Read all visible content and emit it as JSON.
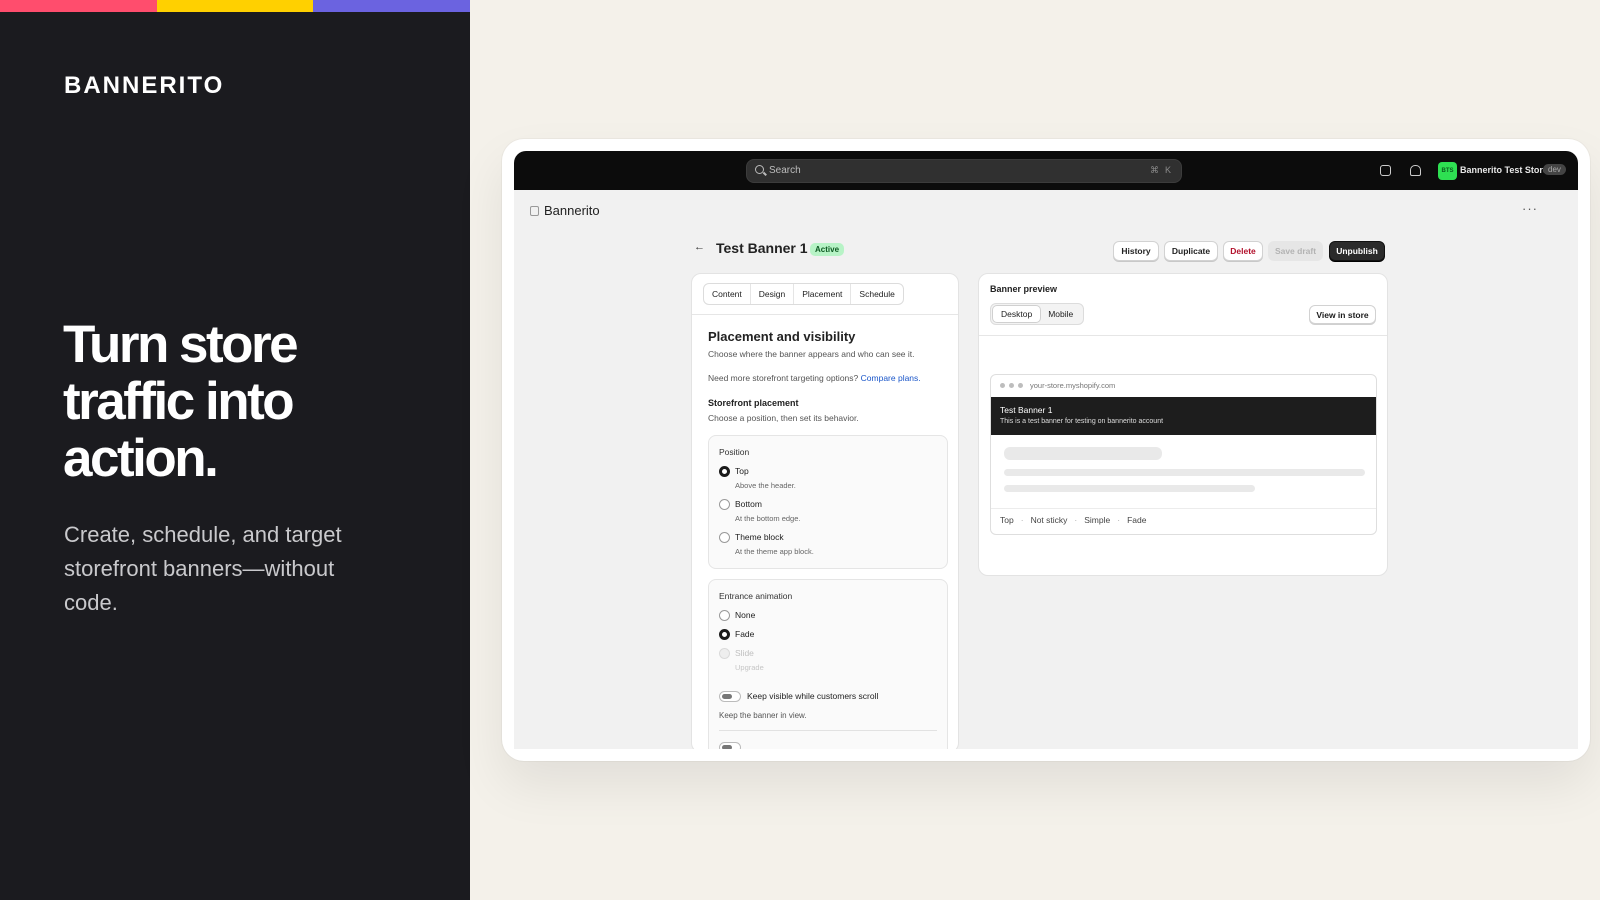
{
  "brand": {
    "logo": "BANNERITO",
    "headline": "Turn store traffic into action.",
    "subheadline": "Create, schedule, and target storefront banners—without code.",
    "stripe_colors": [
      "#ff4d6d",
      "#ffd000",
      "#6b63e0"
    ]
  },
  "topbar": {
    "search_placeholder": "Search",
    "shortcut_cmd": "⌘",
    "shortcut_key": "K",
    "avatar_initials": "BTS",
    "store_name": "Bannerito Test Store",
    "env_badge": "dev",
    "icons": [
      "search-icon",
      "store-icon",
      "bell-icon"
    ]
  },
  "app": {
    "name": "Bannerito",
    "more_label": "···"
  },
  "page": {
    "back_label": "←",
    "title": "Test Banner 1",
    "status": "Active",
    "actions": {
      "history": "History",
      "duplicate": "Duplicate",
      "delete": "Delete",
      "save_draft": "Save draft",
      "unpublish": "Unpublish"
    }
  },
  "editor": {
    "tabs": [
      "Content",
      "Design",
      "Placement",
      "Schedule"
    ],
    "section_title": "Placement and visibility",
    "section_desc": "Choose where the banner appears and who can see it.",
    "upsell_text": "Need more storefront targeting options?",
    "upsell_link": "Compare plans.",
    "storefront_title": "Storefront placement",
    "storefront_desc": "Choose a position, then set its behavior.",
    "position": {
      "label": "Position",
      "selected": "Top",
      "options": [
        {
          "label": "Top",
          "hint": "Above the header."
        },
        {
          "label": "Bottom",
          "hint": "At the bottom edge."
        },
        {
          "label": "Theme block",
          "hint": "At the theme app block."
        }
      ]
    },
    "animation": {
      "label": "Entrance animation",
      "selected": "Fade",
      "options": [
        {
          "label": "None",
          "hint": ""
        },
        {
          "label": "Fade",
          "hint": ""
        },
        {
          "label": "Slide",
          "hint": "Upgrade"
        }
      ]
    },
    "sticky_toggle": {
      "label": "Keep visible while customers scroll",
      "hint": "Keep the banner in view.",
      "enabled": false
    }
  },
  "preview": {
    "title": "Banner preview",
    "modes": [
      "Desktop",
      "Mobile"
    ],
    "selected_mode": "Desktop",
    "view_in_store": "View in store",
    "url": "your-store.myshopify.com",
    "banner_title": "Test Banner 1",
    "banner_body": "This is a test banner for testing on bannerito account",
    "summary": [
      "Top",
      "Not sticky",
      "Simple",
      "Fade"
    ],
    "summary_sep": "·"
  }
}
